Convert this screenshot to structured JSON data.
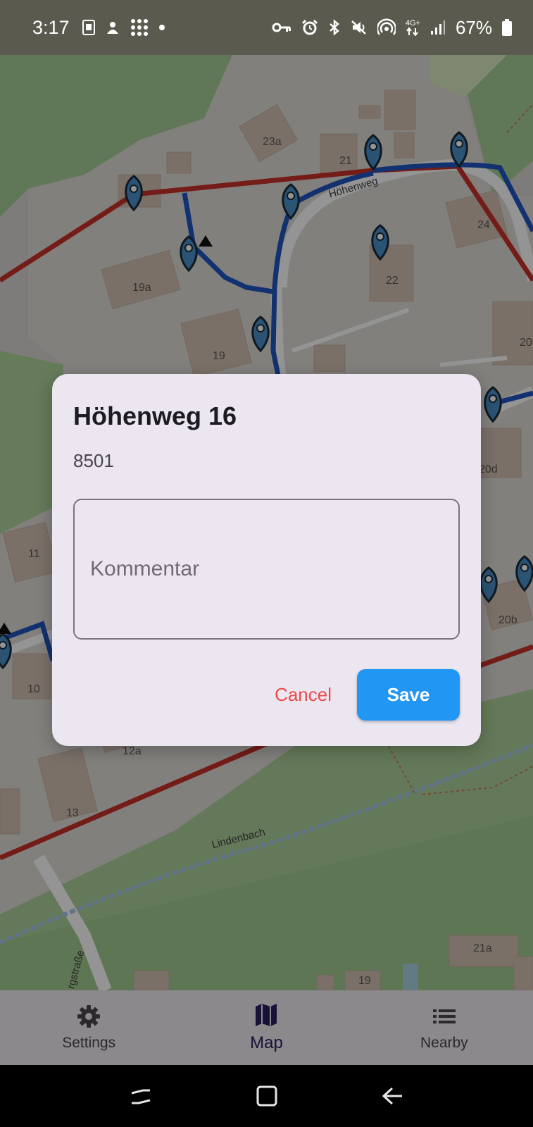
{
  "status_bar": {
    "time": "3:17",
    "battery_percent": "67%",
    "network": "4G+",
    "icons": [
      "sim-icon",
      "notification-app-icon",
      "dots-grid-icon",
      "dot-icon",
      "key-icon",
      "alarm-icon",
      "bluetooth-icon",
      "mute-icon",
      "hotspot-icon",
      "data-arrows-icon",
      "signal-icon",
      "battery-icon"
    ]
  },
  "map": {
    "house_numbers": [
      "23a",
      "21",
      "24",
      "22",
      "19a",
      "19",
      "20",
      "20d",
      "11",
      "20b",
      "10",
      "12a",
      "13",
      "21a",
      "19"
    ],
    "street_labels": [
      "Höhenweg",
      "Lindenbach",
      "rgstraße"
    ]
  },
  "dialog": {
    "title": "Höhenweg 16",
    "subtitle": "8501",
    "comment_placeholder": "Kommentar",
    "comment_value": "",
    "cancel_label": "Cancel",
    "save_label": "Save"
  },
  "bottom_nav": {
    "items": [
      {
        "label": "Settings",
        "icon": "gear-icon",
        "active": false
      },
      {
        "label": "Map",
        "icon": "map-icon",
        "active": true
      },
      {
        "label": "Nearby",
        "icon": "list-icon",
        "active": false
      }
    ]
  },
  "system_nav": {
    "buttons": [
      "recent-apps-icon",
      "home-icon",
      "back-icon"
    ]
  },
  "colors": {
    "accent_save": "#2196f3",
    "cancel_text": "#ee4a4a",
    "dialog_background": "#ece6f0",
    "route_red": "#c8312a",
    "route_blue": "#1f55c3",
    "marker_blue": "#4a8fc9"
  }
}
